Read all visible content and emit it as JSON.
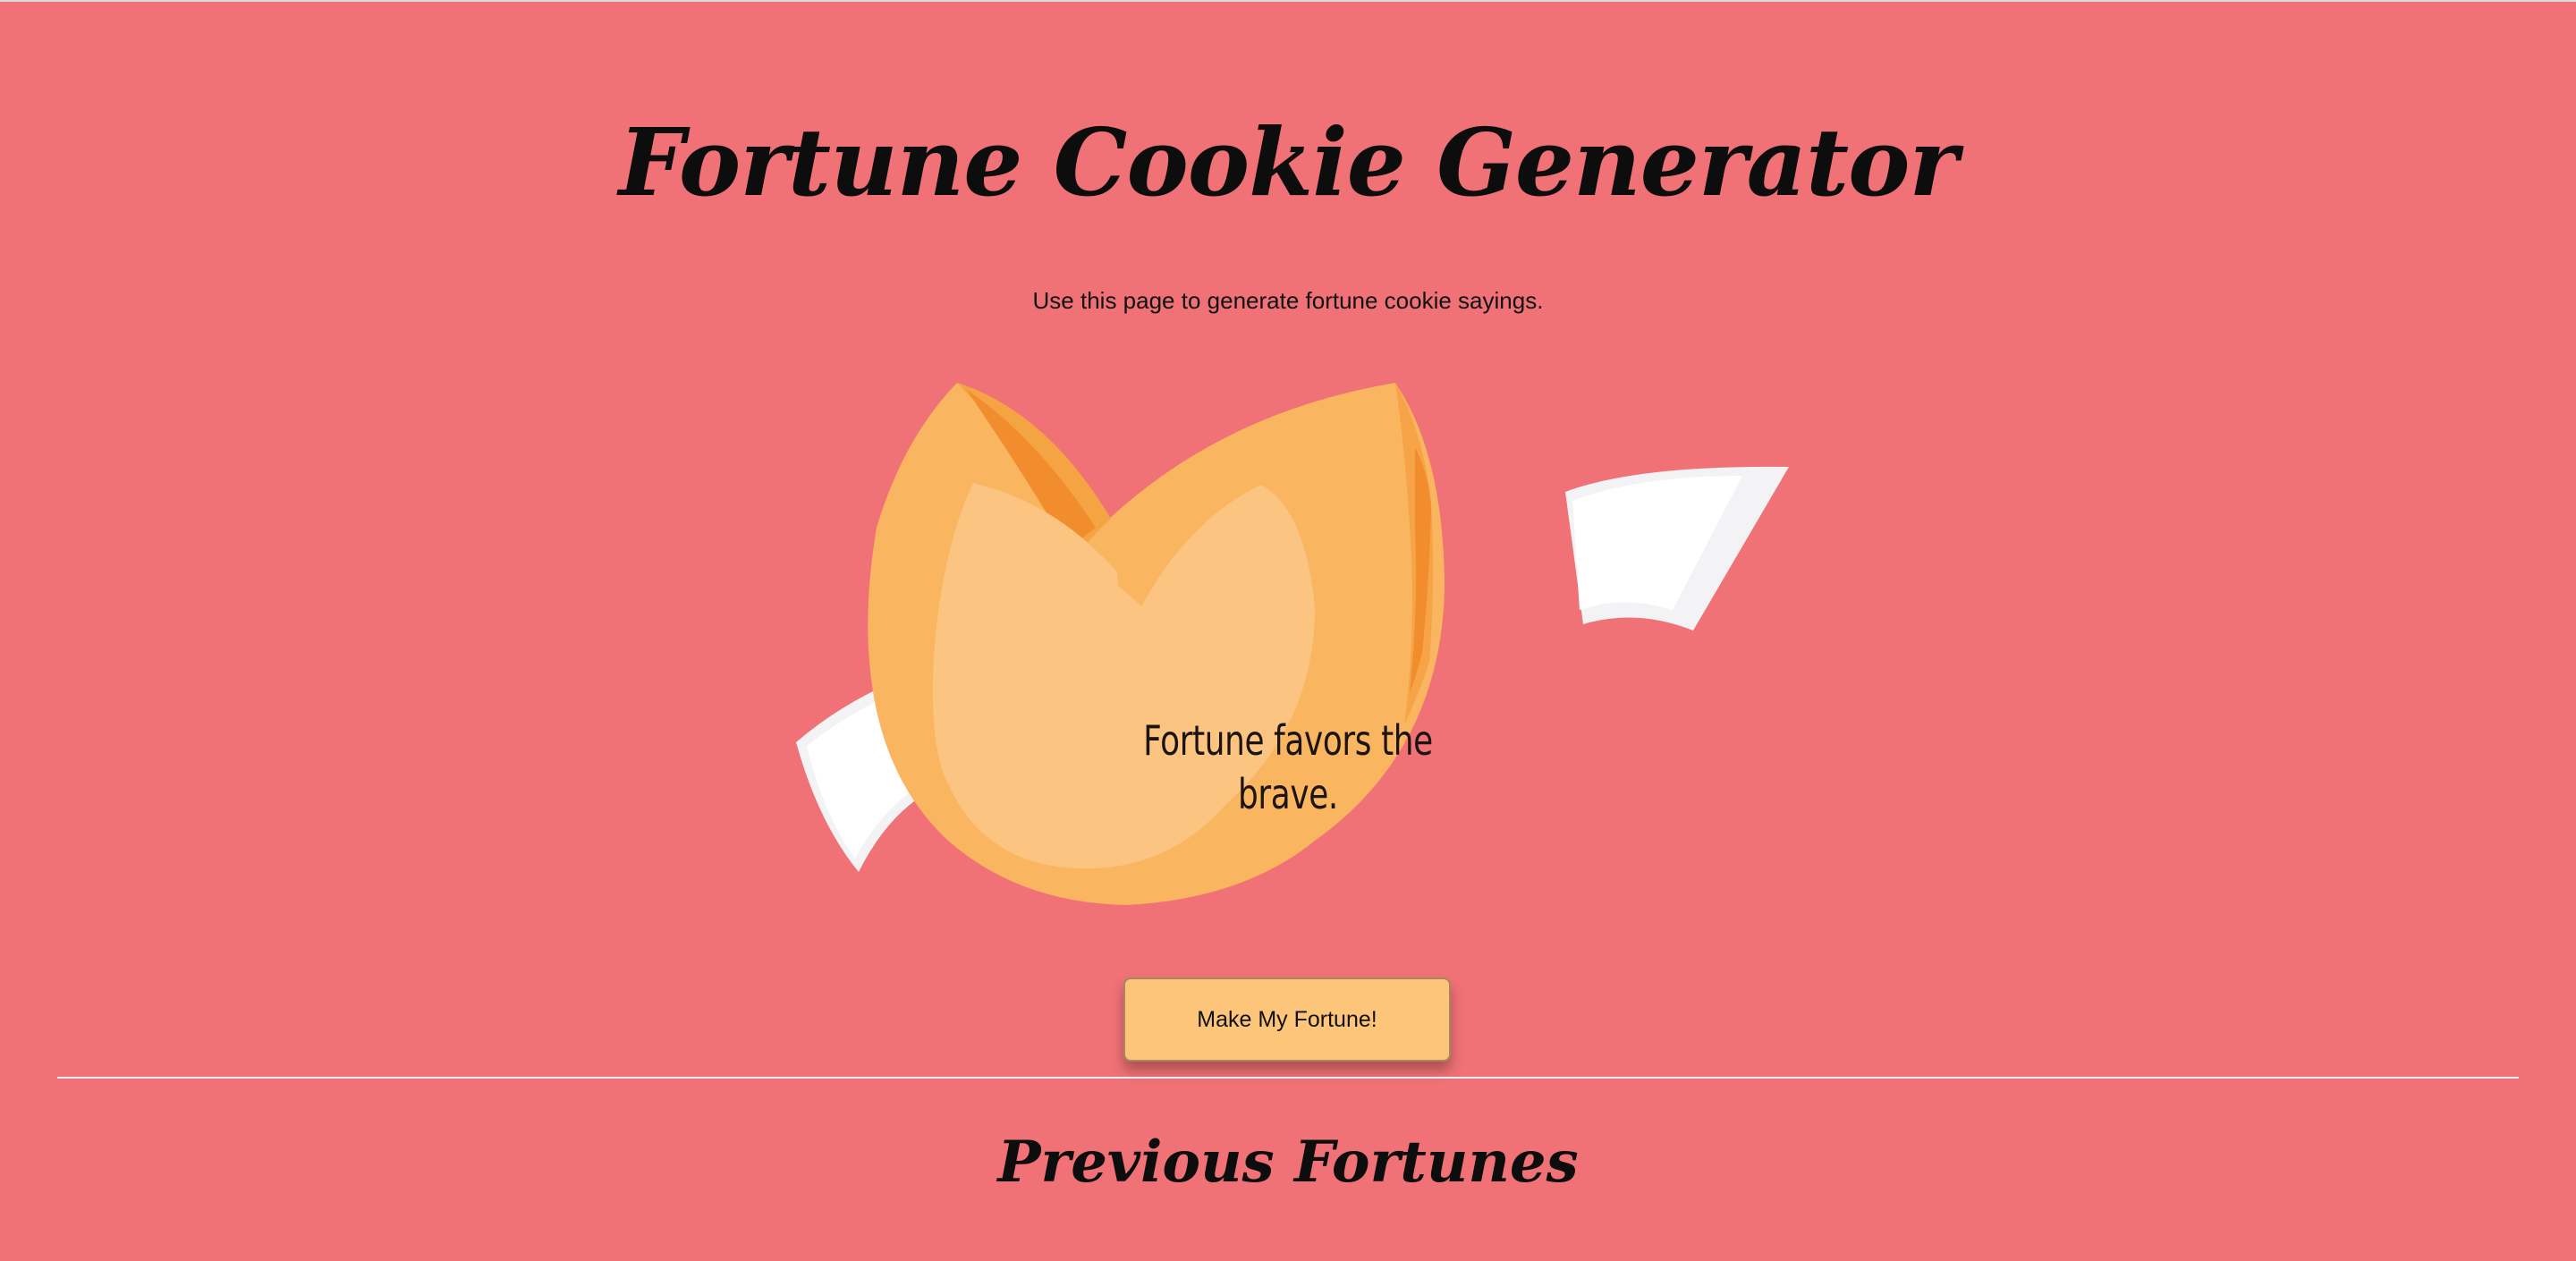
{
  "header": {
    "title": "Fortune Cookie Generator",
    "subtitle": "Use this page to generate fortune cookie sayings."
  },
  "cookie": {
    "fortune_text": "Fortune favors the brave.",
    "colors": {
      "cookie_base": "#f9b55f",
      "cookie_inner": "#fbc480",
      "cookie_shadow": "#f28d2d",
      "paper": "#ffffff",
      "paper_shadow": "#f1f1f4"
    }
  },
  "actions": {
    "make_fortune_label": "Make My Fortune!"
  },
  "history": {
    "title": "Previous Fortunes"
  },
  "theme": {
    "background": "#f07276",
    "button": "#fcc57a"
  }
}
